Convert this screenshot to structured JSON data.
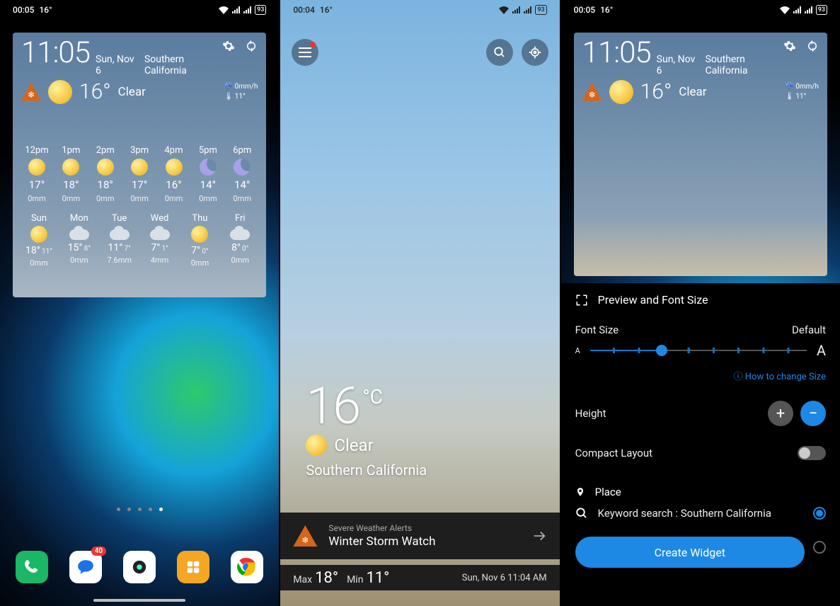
{
  "status": {
    "time_a": "00:05",
    "time_b": "00:04",
    "temp": "16°",
    "battery": "93"
  },
  "widget": {
    "time": "11:05",
    "date": "Sun, Nov 6",
    "location": "Southern California",
    "temp": "16°",
    "cond": "Clear",
    "precip": "0mm/h",
    "feels": "11°",
    "hourly": [
      {
        "h": "12pm",
        "t": "17°",
        "m": "0mm",
        "ic": "sun"
      },
      {
        "h": "1pm",
        "t": "18°",
        "m": "0mm",
        "ic": "sun"
      },
      {
        "h": "2pm",
        "t": "18°",
        "m": "0mm",
        "ic": "sun"
      },
      {
        "h": "3pm",
        "t": "17°",
        "m": "0mm",
        "ic": "sun"
      },
      {
        "h": "4pm",
        "t": "16°",
        "m": "0mm",
        "ic": "sun"
      },
      {
        "h": "5pm",
        "t": "14°",
        "m": "0mm",
        "ic": "moon"
      },
      {
        "h": "6pm",
        "t": "14°",
        "m": "0mm",
        "ic": "moon"
      }
    ],
    "daily": [
      {
        "d": "Sun",
        "hi": "18°",
        "lo": "11°",
        "m": "0mm",
        "ic": "sun"
      },
      {
        "d": "Mon",
        "hi": "15°",
        "lo": "8°",
        "m": "0mm",
        "ic": "cloud"
      },
      {
        "d": "Tue",
        "hi": "11°",
        "lo": "7°",
        "m": "7.6mm",
        "ic": "cloud"
      },
      {
        "d": "Wed",
        "hi": "7°",
        "lo": "1°",
        "m": "4mm",
        "ic": "cloud"
      },
      {
        "d": "Thu",
        "hi": "7°",
        "lo": "0°",
        "m": "0mm",
        "ic": "sun"
      },
      {
        "d": "Fri",
        "hi": "8°",
        "lo": "0°",
        "m": "0mm",
        "ic": "cloud"
      }
    ]
  },
  "dock": {
    "msg_badge": "40"
  },
  "app": {
    "temp": "16",
    "unit": "°C",
    "cond": "Clear",
    "loc": "Southern California",
    "alert_sub": "Severe Weather Alerts",
    "alert_title": "Winter Storm Watch",
    "max_lbl": "Max",
    "max": "18°",
    "min_lbl": "Min",
    "min": "11°",
    "stamp": "Sun, Nov 6 11:04 AM"
  },
  "cfg": {
    "preview": "Preview and Font Size",
    "font_label": "Font Size",
    "font_default": "Default",
    "info": "How to change Size",
    "height": "Height",
    "compact": "Compact Layout",
    "place": "Place",
    "search": "Keyword search : Southern California",
    "create": "Create Widget"
  }
}
